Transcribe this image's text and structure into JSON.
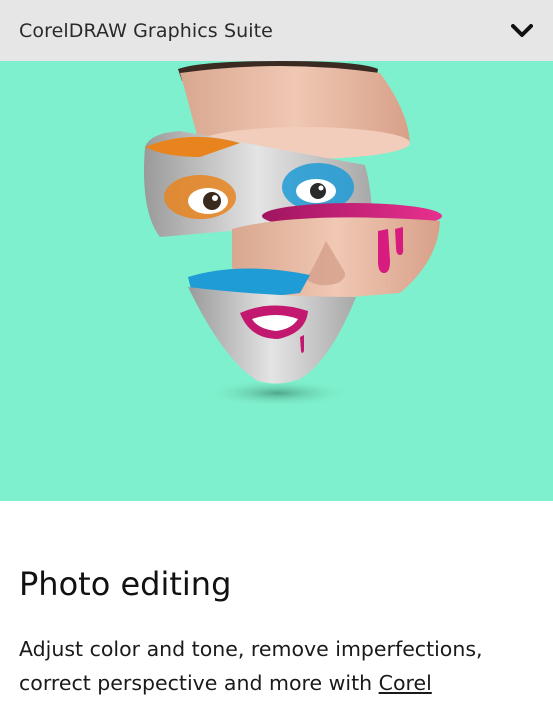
{
  "header": {
    "title": "CorelDRAW Graphics Suite",
    "toggle_icon": "chevron-down-icon"
  },
  "hero": {
    "background_color": "#7ff0cd",
    "image_description_icon": "sliced-face-artwork"
  },
  "content": {
    "title": "Photo editing",
    "body_text": "Adjust color and tone, remove imperfections, correct perspective and more with ",
    "link_text": "Corel"
  },
  "colors": {
    "header_bg": "#e6e6e6",
    "hero_bg": "#7ff0cd",
    "accent_orange": "#e8841e",
    "accent_blue": "#1f9bd6",
    "accent_magenta": "#d81b7f"
  }
}
